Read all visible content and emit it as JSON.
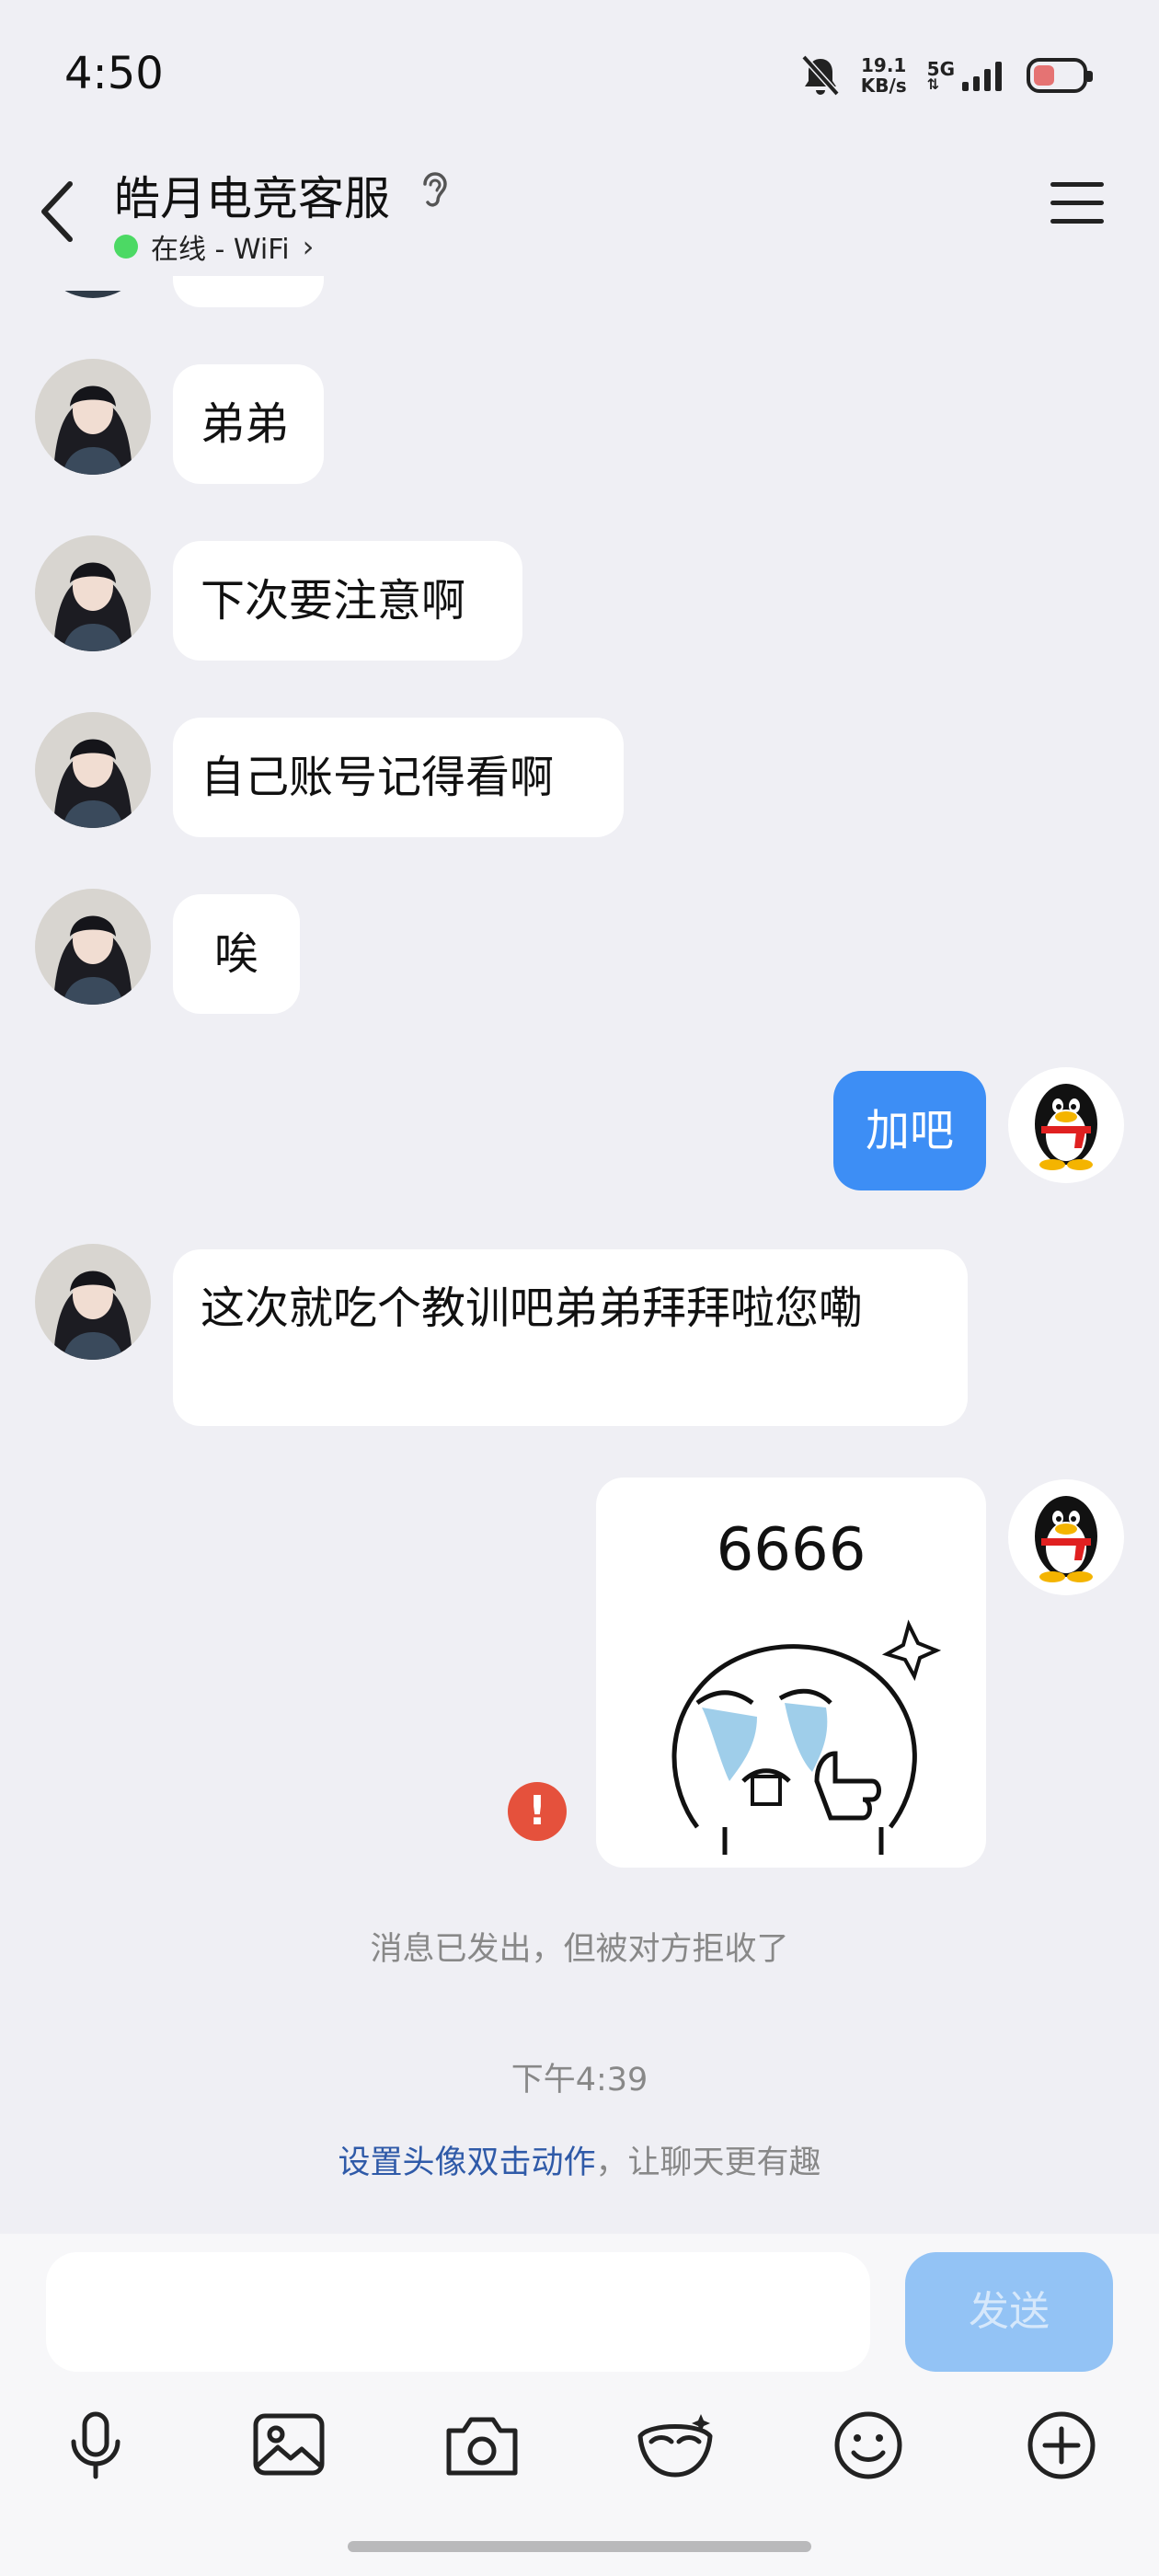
{
  "status": {
    "time": "4:50",
    "speed_value": "19.1",
    "speed_unit": "KB/s",
    "network": "5G",
    "battery_color": "#e57373"
  },
  "header": {
    "title": "皓月电竞客服",
    "status_text": "在线 - WiFi",
    "status_color": "#4cd964"
  },
  "messages": [
    {
      "side": "left",
      "text": "弟弟"
    },
    {
      "side": "left",
      "text": "下次要注意啊"
    },
    {
      "side": "left",
      "text": "自己账号记得看啊"
    },
    {
      "side": "left",
      "text": "唉"
    },
    {
      "side": "right",
      "text": "加吧"
    },
    {
      "side": "left",
      "text": "这次就吃个教训吧弟弟拜拜啦您嘞"
    },
    {
      "side": "right",
      "type": "sticker",
      "text": "6666"
    }
  ],
  "system": {
    "rejected_notice": "消息已发出，但被对方拒收了",
    "timestamp": "下午4:39",
    "tip_link": "设置头像双击动作",
    "tip_rest": "，让聊天更有趣"
  },
  "composer": {
    "send_label": "发送"
  },
  "toolbar": {
    "icons": [
      "microphone-icon",
      "image-icon",
      "camera-icon",
      "face-mask-icon",
      "emoji-icon",
      "plus-icon"
    ]
  },
  "colors": {
    "my_bubble": "#3d8ef5",
    "send_button": "#93c3f5",
    "link": "#2f5aa8",
    "error": "#e5513c"
  }
}
